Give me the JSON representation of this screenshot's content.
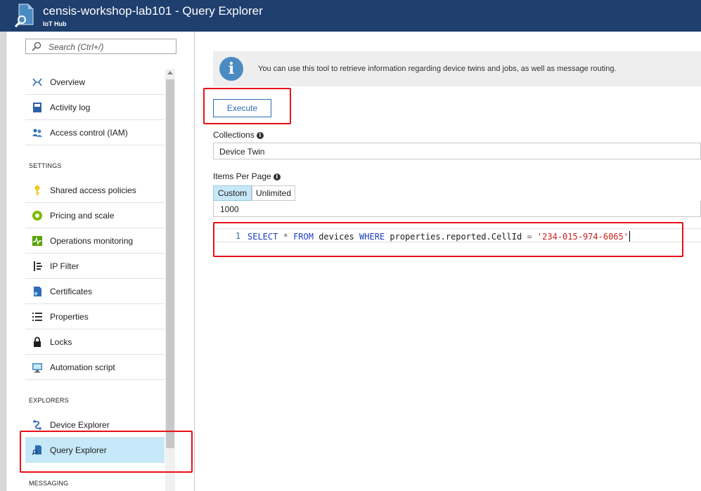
{
  "header": {
    "title": "censis-workshop-lab101 - Query Explorer",
    "subtitle": "IoT Hub",
    "colors": {
      "bar": "#1f3f6e",
      "text": "#ffffff"
    }
  },
  "sidebar": {
    "search_placeholder": "Search (Ctrl+/)",
    "items": [
      {
        "label": "Overview",
        "icon": "overview-icon"
      },
      {
        "label": "Activity log",
        "icon": "activity-log-icon"
      },
      {
        "label": "Access control (IAM)",
        "icon": "people-icon"
      }
    ],
    "sections": [
      {
        "label": "SETTINGS",
        "items": [
          {
            "label": "Shared access policies",
            "icon": "key-icon"
          },
          {
            "label": "Pricing and scale",
            "icon": "pricing-icon"
          },
          {
            "label": "Operations monitoring",
            "icon": "monitoring-icon"
          },
          {
            "label": "IP Filter",
            "icon": "ip-filter-icon"
          },
          {
            "label": "Certificates",
            "icon": "certificate-icon"
          },
          {
            "label": "Properties",
            "icon": "properties-list-icon"
          },
          {
            "label": "Locks",
            "icon": "lock-icon"
          },
          {
            "label": "Automation script",
            "icon": "automation-icon"
          }
        ]
      },
      {
        "label": "EXPLORERS",
        "items": [
          {
            "label": "Device Explorer",
            "icon": "device-explorer-icon"
          },
          {
            "label": "Query Explorer",
            "icon": "query-explorer-icon",
            "selected": true
          }
        ]
      },
      {
        "label": "MESSAGING",
        "items": []
      }
    ],
    "selected_color": "#c7e8f9"
  },
  "main": {
    "info_text": "You can use this tool to retrieve information regarding device twins and jobs, as well as message routing.",
    "execute_label": "Execute",
    "collections_label": "Collections",
    "collections_value": "Device Twin",
    "items_per_page_label": "Items Per Page",
    "items_per_page_options": [
      "Custom",
      "Unlimited"
    ],
    "items_per_page_selected": "Custom",
    "items_per_page_value": "1000",
    "query": {
      "line_number": "1",
      "tokens": [
        "SELECT",
        "*",
        "FROM",
        "devices",
        "WHERE",
        "properties.reported.CellId",
        "=",
        "'234-015-974-6065'"
      ]
    }
  },
  "highlight_color": "#e8101a"
}
